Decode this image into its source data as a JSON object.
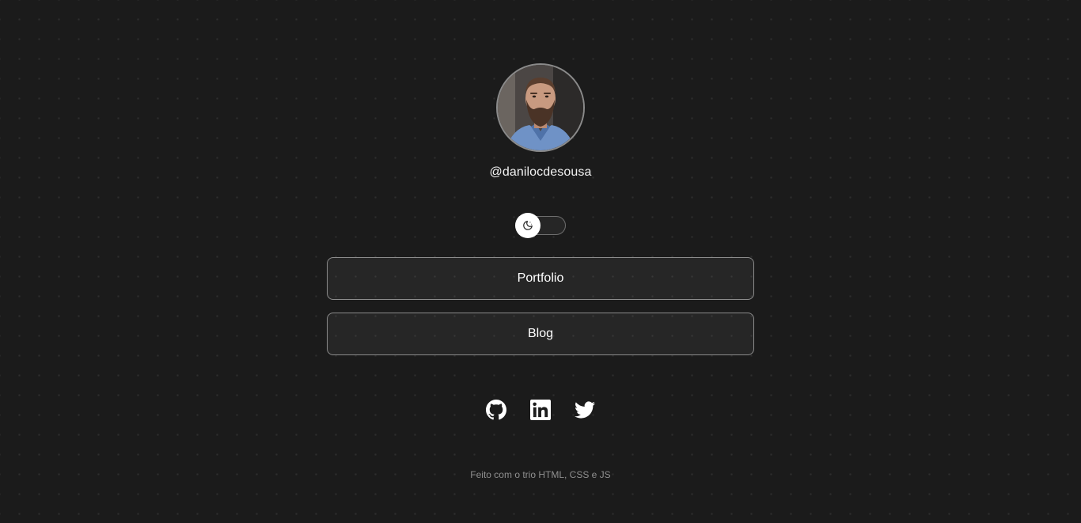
{
  "profile": {
    "username": "@danilocdesousa",
    "avatar_alt": "Foto de Danilo"
  },
  "theme_switch": {
    "icon": "moon-icon"
  },
  "links": [
    {
      "label": "Portfolio"
    },
    {
      "label": "Blog"
    }
  ],
  "social": [
    {
      "icon": "github-icon"
    },
    {
      "icon": "linkedin-icon"
    },
    {
      "icon": "twitter-icon"
    }
  ],
  "footer": {
    "text": "Feito com o trio HTML, CSS e JS"
  },
  "colors": {
    "background": "#1b1b1b",
    "text": "#ffffff",
    "border": "#8c8c8c",
    "footer_text": "#8f8f8f"
  }
}
